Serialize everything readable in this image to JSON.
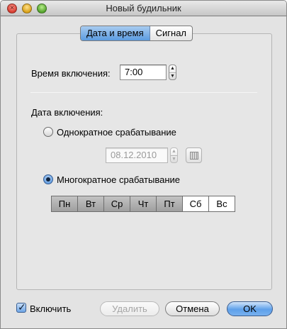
{
  "window": {
    "title": "Новый будильник"
  },
  "tabs": [
    {
      "label": "Дата и время",
      "selected": true
    },
    {
      "label": "Сигнал",
      "selected": false
    }
  ],
  "time": {
    "label": "Время включения:",
    "value": "7:00"
  },
  "date": {
    "label": "Дата включения:",
    "once": {
      "label": "Однократное срабатывание",
      "selected": false,
      "date_value": "08.12.2010"
    },
    "repeat": {
      "label": "Многократное срабатывание",
      "selected": true
    }
  },
  "weekdays": [
    {
      "label": "Пн",
      "selected": true
    },
    {
      "label": "Вт",
      "selected": true
    },
    {
      "label": "Ср",
      "selected": true
    },
    {
      "label": "Чт",
      "selected": true
    },
    {
      "label": "Пт",
      "selected": true
    },
    {
      "label": "Сб",
      "selected": false
    },
    {
      "label": "Вс",
      "selected": false
    }
  ],
  "footer": {
    "enable_label": "Включить",
    "enable_checked": true,
    "delete_label": "Удалить",
    "cancel_label": "Отмена",
    "ok_label": "OK"
  },
  "colors": {
    "selection_blue": "#5b9be0",
    "window_bg": "#e3e3e3"
  },
  "icons": {
    "stepper": "up-down-arrows",
    "calendar": "calendar-icon",
    "check": "checkmark"
  }
}
